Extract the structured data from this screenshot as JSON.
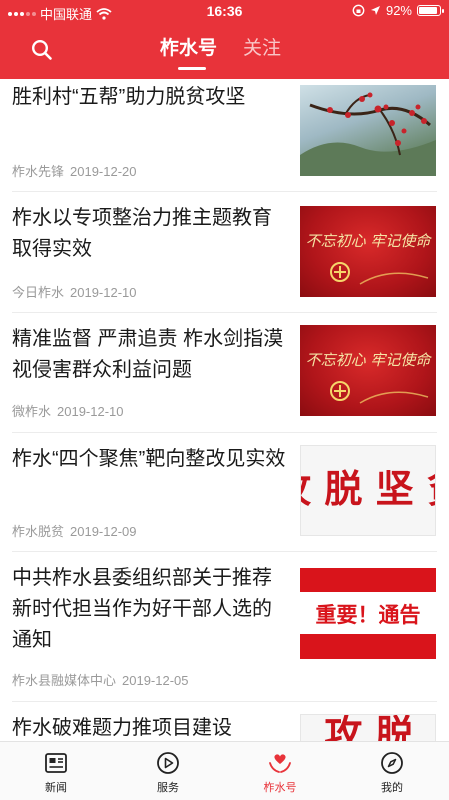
{
  "status_bar": {
    "carrier": "中国联通",
    "time": "16:36",
    "battery": "92%",
    "battery_level": 0.92
  },
  "nav": {
    "tabs": [
      {
        "label": "柞水号",
        "active": true
      },
      {
        "label": "关注",
        "active": false
      }
    ]
  },
  "feed": [
    {
      "title": "胜利村“五帮”助力脱贫攻坚",
      "source": "柞水先锋",
      "date": "2019-12-20",
      "thumb": "plum-blossom-photo"
    },
    {
      "title": "柞水以专项整治力推主题教育取得实效",
      "source": "今日柞水",
      "date": "2019-12-10",
      "thumb": "red-banner-image",
      "thumb_text": "不忘初心 牢记使命"
    },
    {
      "title": "精准监督 严肃追责 柞水剑指漠视侵害群众利益问题",
      "source": "微柞水",
      "date": "2019-12-10",
      "thumb": "red-banner-image",
      "thumb_text": "不忘初心 牢记使命"
    },
    {
      "title": "柞水“四个聚焦”靶向整改见实效",
      "source": "柞水脱贫",
      "date": "2019-12-09",
      "thumb": "calligraphy-image",
      "thumb_text": "攻 脱 坚 贫"
    },
    {
      "title": "中共柞水县委组织部关于推荐新时代担当作为好干部人选的通知",
      "source": "柞水县融媒体中心",
      "date": "2019-12-05",
      "thumb": "notice-image",
      "thumb_text": "重要！通告"
    },
    {
      "title": "柞水破难题力推项目建设",
      "source": "",
      "date": "",
      "thumb": "calligraphy-image",
      "thumb_text": "攻 脱"
    }
  ],
  "bottom_nav": [
    {
      "label": "新闻",
      "icon": "newspaper-icon",
      "active": false
    },
    {
      "label": "服务",
      "icon": "play-circle-icon",
      "active": false
    },
    {
      "label": "柞水号",
      "icon": "heart-hands-icon",
      "active": true
    },
    {
      "label": "我的",
      "icon": "compass-icon",
      "active": false
    }
  ],
  "colors": {
    "brand_red": "#e8333a",
    "meta_gray": "#9a9a9a",
    "title_text": "#1a1a1a"
  }
}
